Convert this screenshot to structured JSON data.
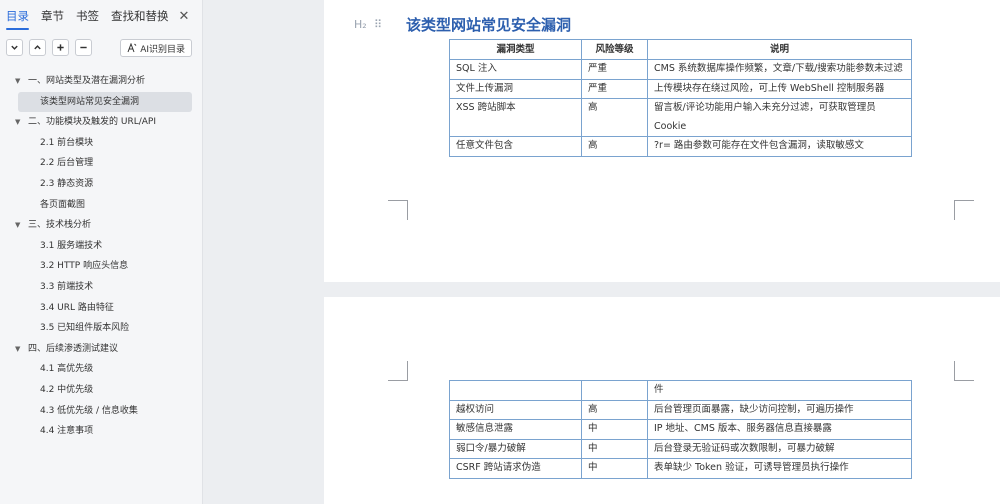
{
  "sidebar": {
    "tabs": [
      "目录",
      "章节",
      "书签",
      "查找和替换"
    ],
    "close": "✕",
    "ai_button": "AI识别目录",
    "toc": [
      {
        "label": "一、网站类型及潜在漏洞分析",
        "level": 1,
        "caret": "▼"
      },
      {
        "label": "该类型网站常见安全漏洞",
        "level": 2,
        "selected": true
      },
      {
        "label": "二、功能模块及触发的 URL/API",
        "level": 1,
        "caret": "▼"
      },
      {
        "label": "2.1 前台模块",
        "level": 2
      },
      {
        "label": "2.2 后台管理",
        "level": 2
      },
      {
        "label": "2.3 静态资源",
        "level": 2
      },
      {
        "label": "各页面截图",
        "level": 2
      },
      {
        "label": "三、技术栈分析",
        "level": 1,
        "caret": "▼"
      },
      {
        "label": "3.1 服务端技术",
        "level": 2
      },
      {
        "label": "3.2 HTTP 响应头信息",
        "level": 2
      },
      {
        "label": "3.3 前端技术",
        "level": 2
      },
      {
        "label": "3.4 URL 路由特征",
        "level": 2
      },
      {
        "label": "3.5 已知组件版本风险",
        "level": 2
      },
      {
        "label": "四、后续渗透测试建议",
        "level": 1,
        "caret": "▼"
      },
      {
        "label": "4.1 高优先级",
        "level": 2
      },
      {
        "label": "4.2 中优先级",
        "level": 2
      },
      {
        "label": "4.3 低优先级 / 信息收集",
        "level": 2
      },
      {
        "label": "4.4 注意事项",
        "level": 2
      }
    ]
  },
  "document": {
    "heading_marker": "H₂",
    "drag_handle": "⠿",
    "heading": "该类型网站常见安全漏洞",
    "headers": [
      "漏洞类型",
      "风险等级",
      "说明"
    ],
    "rows_page1": [
      [
        "SQL 注入",
        "严重",
        "CMS 系统数据库操作频繁，文章/下载/搜索功能参数未过滤"
      ],
      [
        "文件上传漏洞",
        "严重",
        "上传模块存在绕过风险，可上传 WebShell 控制服务器"
      ],
      [
        "XSS 跨站脚本",
        "高",
        "留言板/评论功能用户输入未充分过滤，可获取管理员 Cookie"
      ],
      [
        "任意文件包含",
        "高",
        "?r= 路由参数可能存在文件包含漏洞，读取敏感文"
      ]
    ],
    "continuation": "件",
    "rows_page2": [
      [
        "越权访问",
        "高",
        "后台管理页面暴露，缺少访问控制，可遍历操作"
      ],
      [
        "敏感信息泄露",
        "中",
        "IP 地址、CMS 版本、服务器信息直接暴露"
      ],
      [
        "弱口令/暴力破解",
        "中",
        "后台登录无验证码或次数限制，可暴力破解"
      ],
      [
        "CSRF 跨站请求伪造",
        "中",
        "表单缺少 Token 验证，可诱导管理员执行操作"
      ]
    ]
  }
}
